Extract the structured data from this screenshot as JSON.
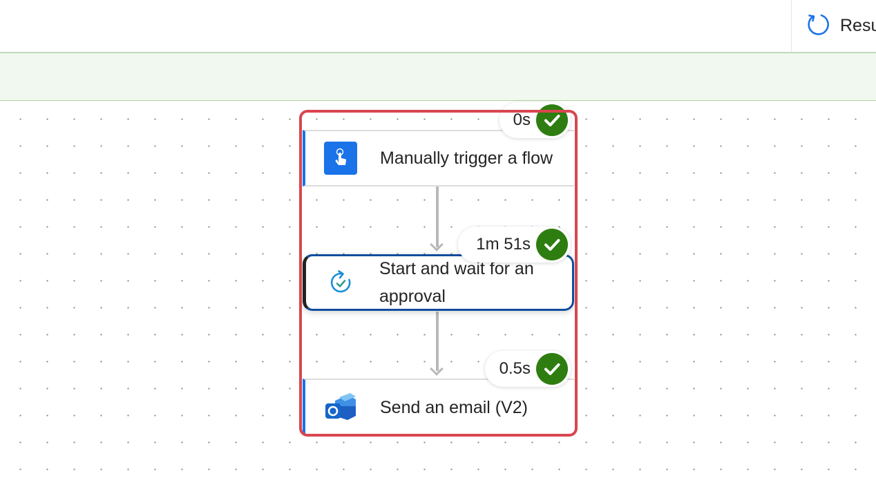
{
  "toolbar": {
    "resubmit_label": "Resu",
    "resubmit_icon": "refresh-icon"
  },
  "flow": {
    "steps": [
      {
        "title": "Manually trigger a flow",
        "duration": "0s",
        "status": "succeeded",
        "icon": "manual-trigger-icon",
        "icon_color": "#1a73e8"
      },
      {
        "title": "Start and wait for an approval",
        "duration": "1m 51s",
        "status": "succeeded",
        "icon": "approval-icon",
        "icon_color": "#1a8fd8"
      },
      {
        "title": "Send an email (V2)",
        "duration": "0.5s",
        "status": "succeeded",
        "icon": "outlook-icon",
        "icon_color": "#1466c8"
      }
    ]
  },
  "colors": {
    "success": "#2e7d10",
    "highlight": "#d9464f",
    "banner": "#f1f8ef",
    "selected_border": "#0f4c9c"
  }
}
